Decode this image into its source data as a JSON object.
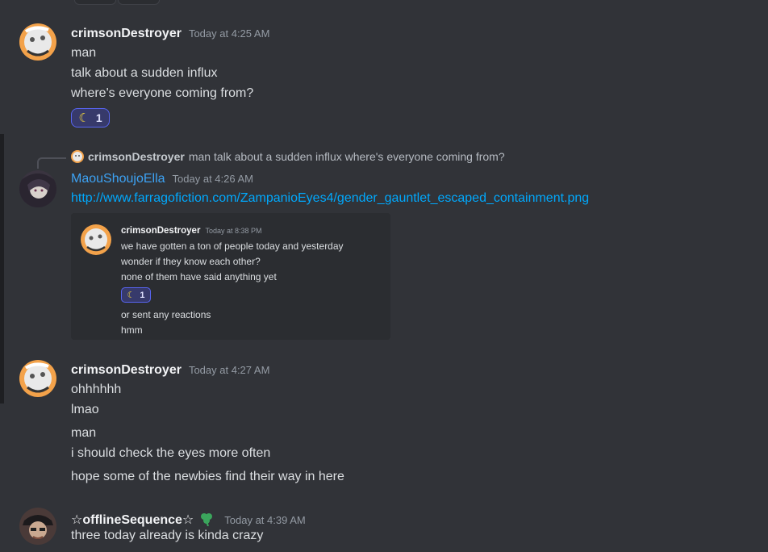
{
  "messages": [
    {
      "username": "crimsonDestroyer",
      "timestamp": "Today at 4:25 AM",
      "lines": [
        "man",
        "talk about a sudden influx",
        "where's everyone coming from?"
      ],
      "reaction": {
        "emoji": "moon",
        "count": "1"
      }
    },
    {
      "reply": {
        "username": "crimsonDestroyer",
        "text": "man talk about a sudden influx where's everyone coming from?"
      },
      "username": "MaouShoujoElla",
      "timestamp": "Today at 4:26 AM",
      "link": "http://www.farragofiction.com/ZampanioEyes4/gender_gauntlet_escaped_containment.png",
      "embed": {
        "username": "crimsonDestroyer",
        "timestamp": "Today at 8:38 PM",
        "lines": [
          "we have gotten a ton of people today and yesterday",
          "wonder if they know each other?",
          "none of them have said anything yet"
        ],
        "reaction": {
          "emoji": "moon",
          "count": "1"
        },
        "lines_after": [
          "or sent any reactions",
          "hmm"
        ]
      }
    },
    {
      "username": "crimsonDestroyer",
      "timestamp": "Today at 4:27 AM",
      "lines": [
        "ohhhhhh",
        "lmao",
        "man",
        "i should check the eyes more often",
        "hope some of the newbies find their way in here"
      ]
    },
    {
      "username": "☆offlineSequence☆",
      "timestamp": "Today at 4:39 AM",
      "badge_icon": "clover-icon",
      "lines": [
        "three today already is kinda crazy"
      ]
    }
  ],
  "colors": {
    "background": "#313338",
    "link": "#00a8fc",
    "username_blue": "#3da3f5",
    "reaction_border": "#5865f2",
    "clover": "#3ba55c"
  }
}
